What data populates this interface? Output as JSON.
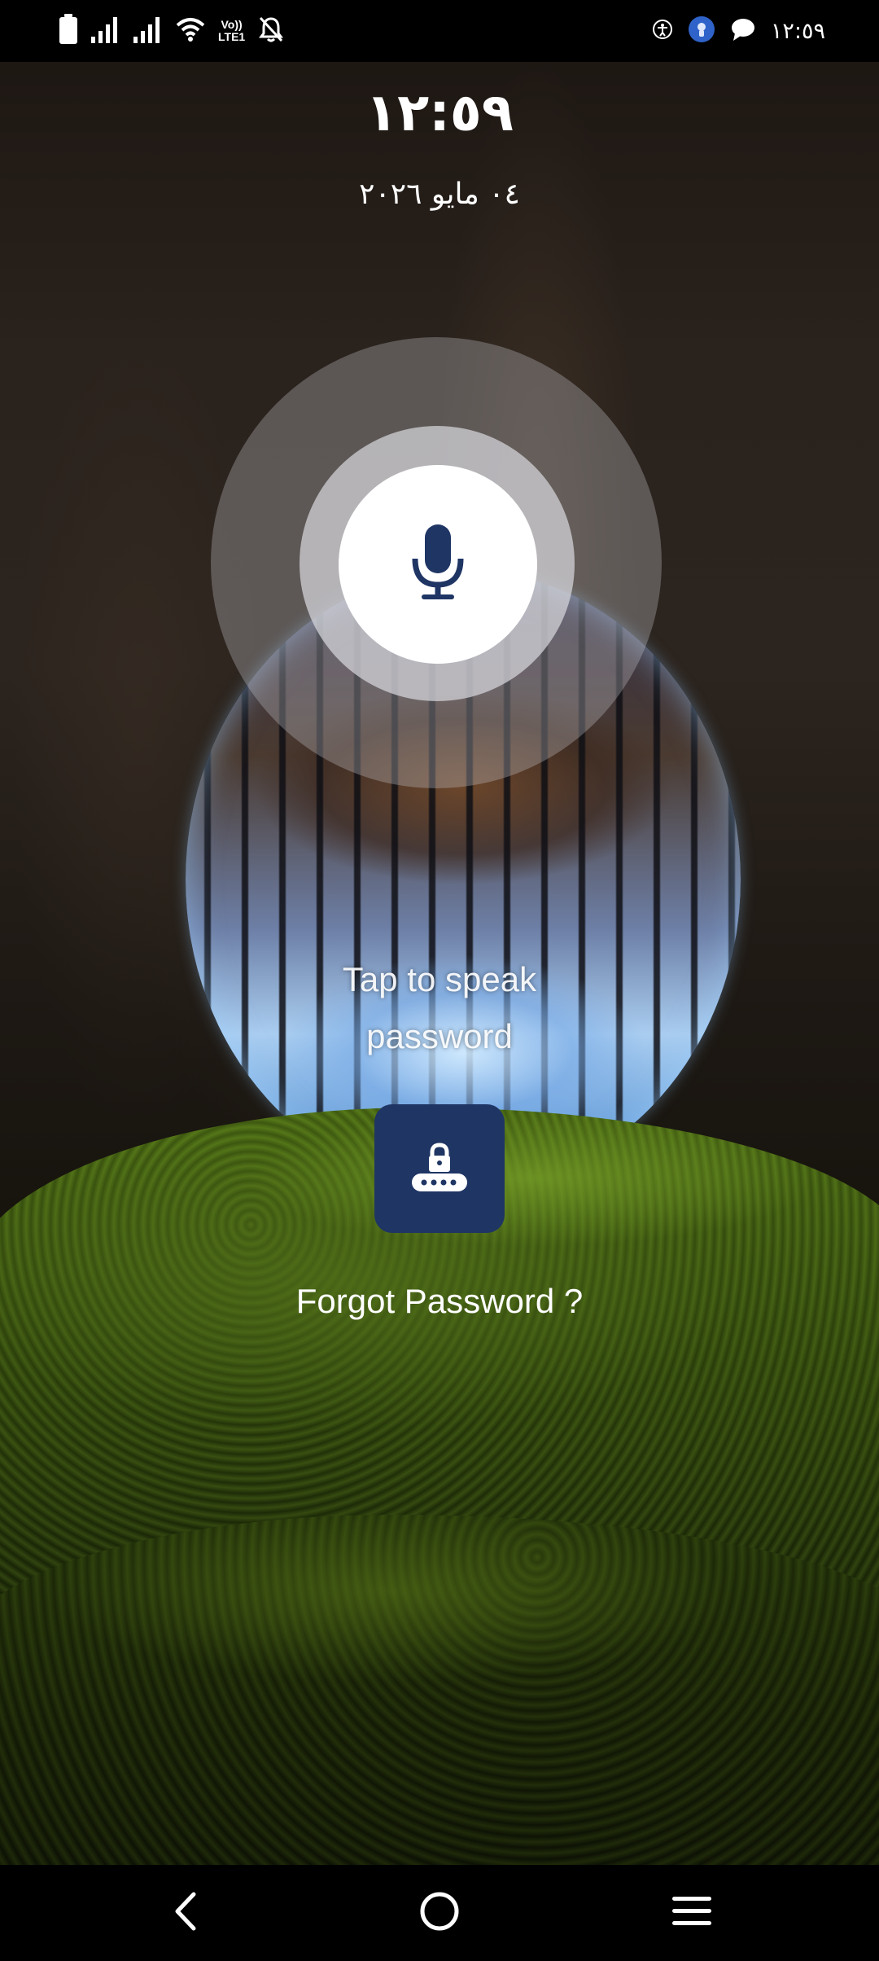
{
  "status_bar": {
    "time": "١٢:٥٩",
    "volte_label_top": "Vo))",
    "volte_label_bottom": "LTE1",
    "left_icons": [
      "battery-icon",
      "signal-icon",
      "signal-icon",
      "wifi-icon",
      "volte-icon",
      "bell-off-icon"
    ],
    "right_icons": [
      "accessibility-icon",
      "app-notification-icon",
      "chat-icon"
    ]
  },
  "lock_screen": {
    "time": "١٢:٥٩",
    "date": "٠٤ مايو ٢٠٢٦",
    "mic_icon": "microphone-icon",
    "tap_prompt": "Tap to speak password",
    "pin_icon": "lock-keypad-icon",
    "forgot_password": "Forgot Password ?"
  },
  "nav_bar": {
    "back_icon": "back-icon",
    "home_icon": "home-icon",
    "recents_icon": "menu-icon"
  },
  "colors": {
    "pin_button": "#1f3564",
    "mic_icon": "#1f3564",
    "text": "#ffffff"
  }
}
